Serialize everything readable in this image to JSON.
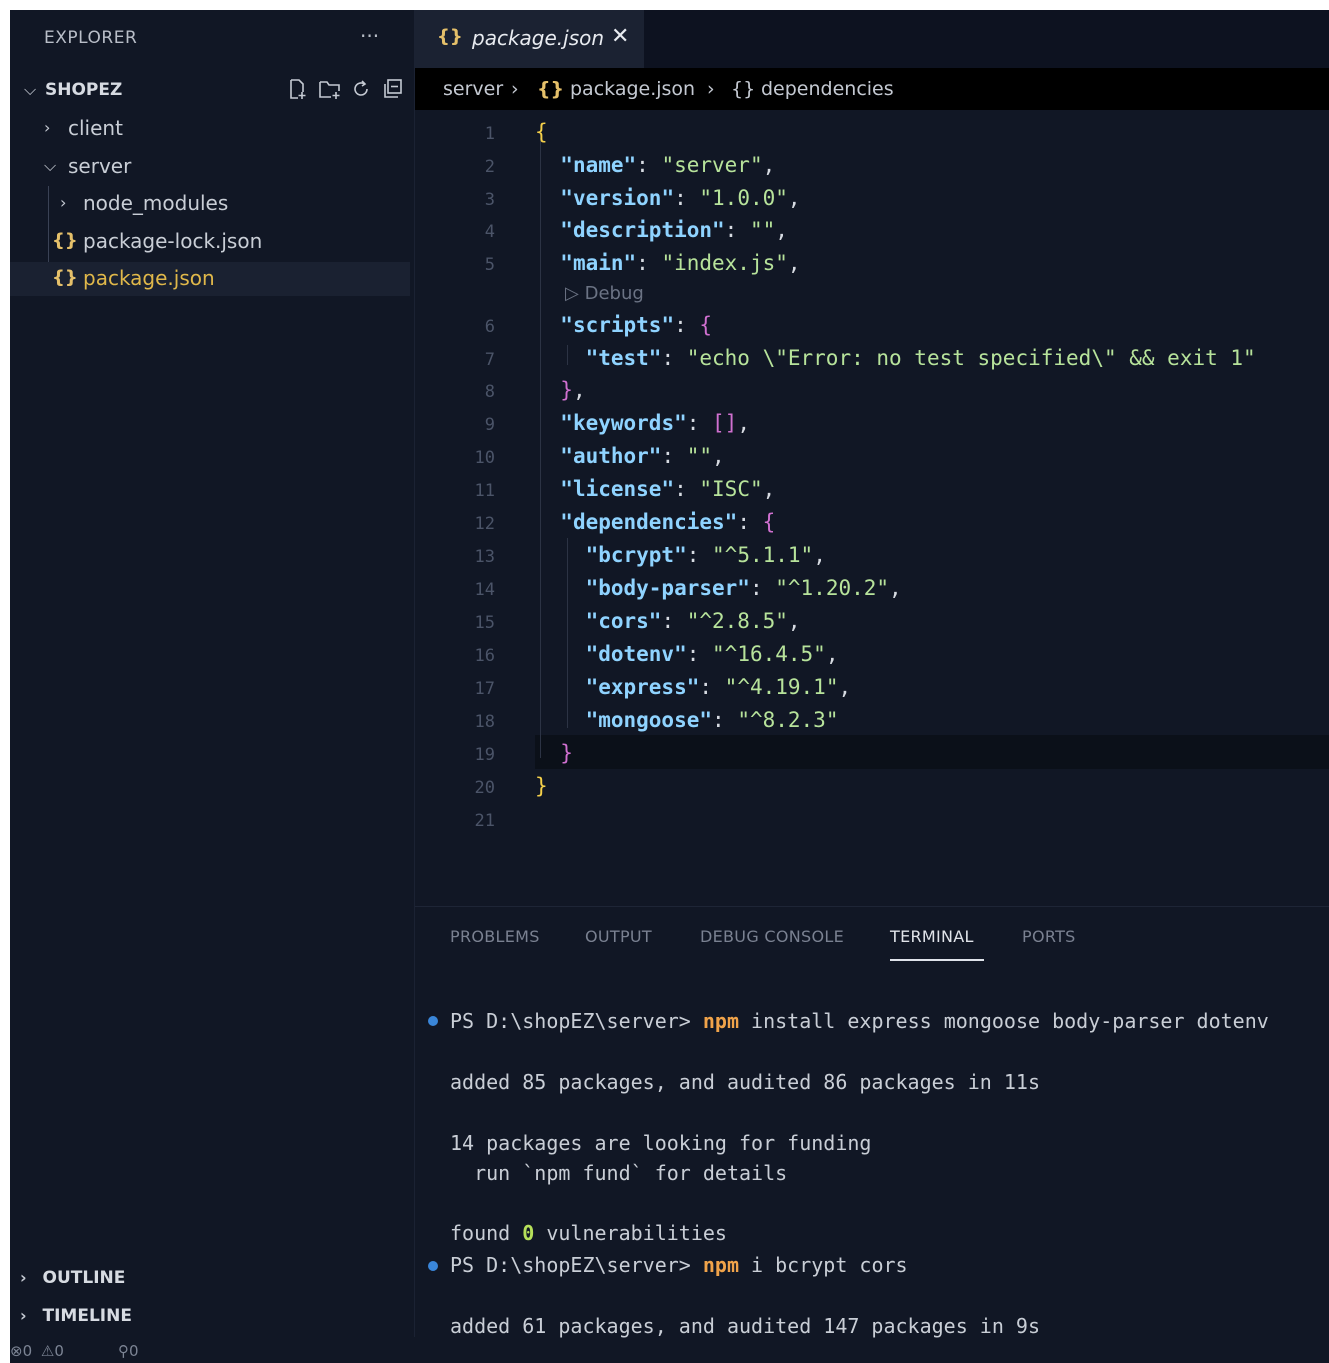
{
  "sidebar": {
    "header": "EXPLORER",
    "more": "···",
    "project": "SHOPEZ",
    "tree": [
      {
        "label": "client"
      },
      {
        "label": "server"
      },
      {
        "label": "node_modules"
      },
      {
        "label": "package-lock.json",
        "icon": "{}"
      },
      {
        "label": "package.json",
        "icon": "{}"
      }
    ],
    "outline": "OUTLINE",
    "timeline": "TIMELINE"
  },
  "status": {
    "errors": "0",
    "warnings": "0",
    "ports": "0"
  },
  "tab": {
    "icon": "{}",
    "title": "package.json",
    "close": "✕"
  },
  "breadcrumb": [
    "server",
    "package.json",
    "dependencies"
  ],
  "editor": {
    "codelens": "Debug",
    "line_numbers": [
      "1",
      "2",
      "3",
      "4",
      "5",
      "6",
      "7",
      "8",
      "9",
      "10",
      "11",
      "12",
      "13",
      "14",
      "15",
      "16",
      "17",
      "18",
      "19",
      "20",
      "21"
    ]
  },
  "panel": {
    "tabs": [
      "PROBLEMS",
      "OUTPUT",
      "DEBUG CONSOLE",
      "TERMINAL",
      "PORTS"
    ],
    "active_tab": "TERMINAL",
    "prompt": "PS D:\\shopEZ\\server>",
    "npm": "npm",
    "cmd1": " install express mongoose body-parser dotenv",
    "out1": "added 85 packages, and audited 86 packages in 11s",
    "out2": "14 packages are looking for funding",
    "out3": "  run `npm fund` for details",
    "out4a": "found ",
    "out4b": "0",
    "out4c": " vulnerabilities",
    "cmd2": " i bcrypt cors",
    "out5": "added 61 packages, and audited 147 packages in 9s"
  },
  "colors": {
    "background": "#111725",
    "key": "#8fd3ff",
    "string": "#b7e39b",
    "bracket_gold": "#f5d04a",
    "npm": "#f0a34a",
    "json_icon": "#e5c06a"
  }
}
